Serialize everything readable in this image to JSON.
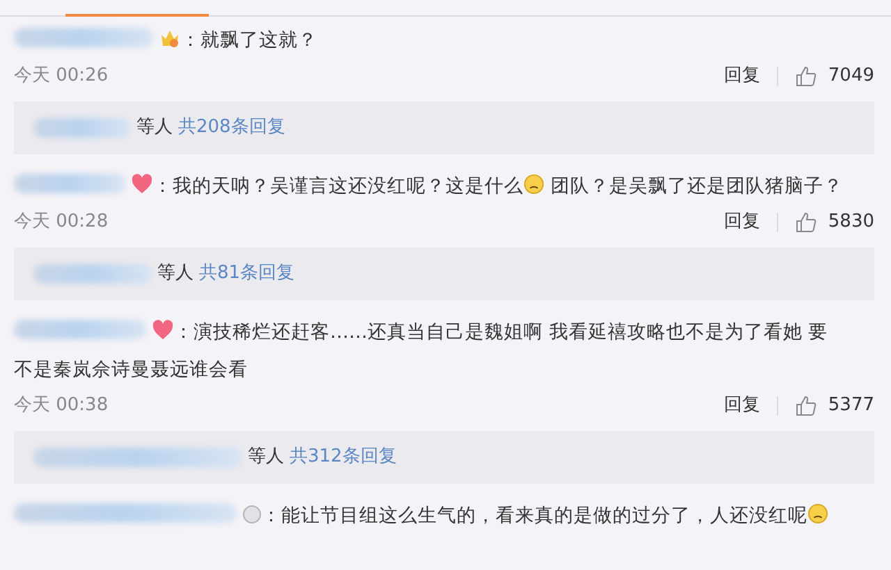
{
  "comments": [
    {
      "badge": {
        "kind": "crown"
      },
      "text": [
        {
          "kind": "text",
          "value": "：就飘了这就？"
        }
      ],
      "time": "今天 00:26",
      "reply": "回复",
      "likes": "7049",
      "thread": {
        "suffix": "等人",
        "link": "共208条回复"
      }
    },
    {
      "badge": {
        "kind": "heart"
      },
      "text": [
        {
          "kind": "text",
          "value": "：我的天呐？吴谨言这还没红呢？这是什么"
        },
        {
          "kind": "emoji"
        },
        {
          "kind": "text",
          "value": " 团队？是吴飘了还是团队猪脑子？"
        }
      ],
      "time": "今天 00:28",
      "reply": "回复",
      "likes": "5830",
      "thread": {
        "suffix": "等人",
        "link": "共81条回复"
      }
    },
    {
      "badge": {
        "kind": "heart"
      },
      "text": [
        {
          "kind": "text",
          "value": "：演技稀烂还赶客……还真当自己是魏姐啊 我看延禧攻略也不是为了看她 要"
        },
        {
          "kind": "break"
        },
        {
          "kind": "text",
          "value": "不是秦岚佘诗曼聂远谁会看"
        }
      ],
      "time": "今天 00:38",
      "reply": "回复",
      "likes": "5377",
      "thread": {
        "suffix": "等人",
        "link": "共312条回复"
      }
    },
    {
      "badge": {
        "kind": "dot"
      },
      "text": [
        {
          "kind": "text",
          "value": "：能让节目组这么生气的，看来真的是做的过分了，人还没红呢"
        },
        {
          "kind": "emoji"
        }
      ]
    }
  ]
}
